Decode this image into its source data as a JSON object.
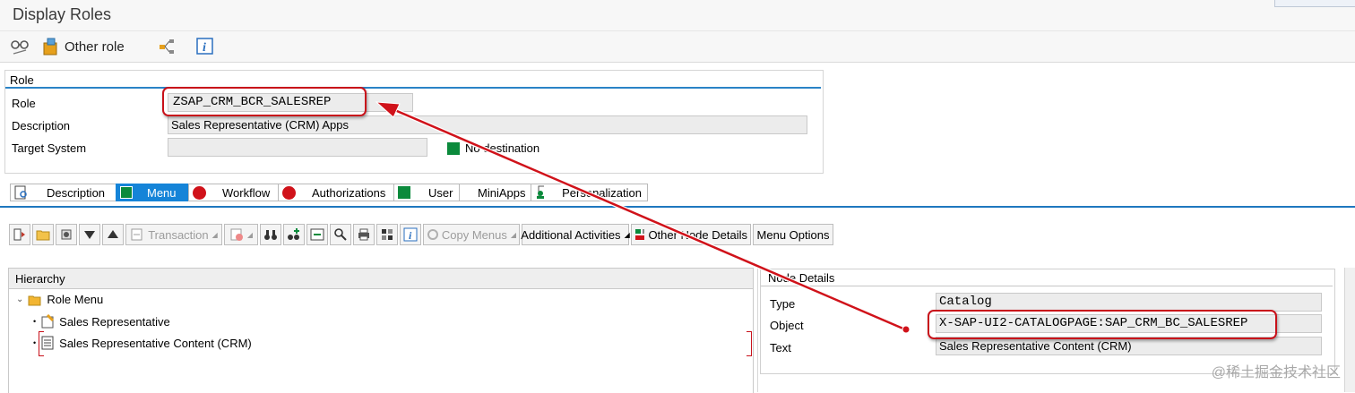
{
  "window": {
    "title": "Display Roles"
  },
  "toolbar": {
    "other_role_label": "Other role"
  },
  "role_section": {
    "header": "Role",
    "role_label": "Role",
    "role_value": "ZSAP_CRM_BCR_SALESREP",
    "description_label": "Description",
    "description_value": "Sales Representative (CRM) Apps",
    "target_system_label": "Target System",
    "target_system_value": "",
    "destination_text": "No destination"
  },
  "tabs": [
    {
      "label": "Description",
      "status": "icon"
    },
    {
      "label": "Menu",
      "status": "green",
      "active": true
    },
    {
      "label": "Workflow",
      "status": "red"
    },
    {
      "label": "Authorizations",
      "status": "red"
    },
    {
      "label": "User",
      "status": "green"
    },
    {
      "label": "MiniApps",
      "status": "none"
    },
    {
      "label": "Personalization",
      "status": "icon"
    }
  ],
  "menu_toolbar": {
    "transaction_label": "Transaction",
    "copy_menus_label": "Copy Menus",
    "additional_activities_label": "Additional Activities",
    "other_node_details_label": "Other Node Details",
    "menu_options_label": "Menu Options"
  },
  "hierarchy": {
    "header": "Hierarchy",
    "root": "Role Menu",
    "items": [
      "Sales Representative",
      "Sales Representative Content (CRM)"
    ]
  },
  "node_details": {
    "header": "Node Details",
    "type_label": "Type",
    "type_value": "Catalog",
    "object_label": "Object",
    "object_value": "X-SAP-UI2-CATALOGPAGE:SAP_CRM_BC_SALESREP",
    "text_label": "Text",
    "text_value": "Sales Representative Content (CRM)"
  },
  "watermark": "@稀土掘金技术社区",
  "colors": {
    "accent": "#1584d8",
    "status_green": "#0b8a3c",
    "status_red": "#d0121a",
    "highlight": "#c8111a"
  }
}
